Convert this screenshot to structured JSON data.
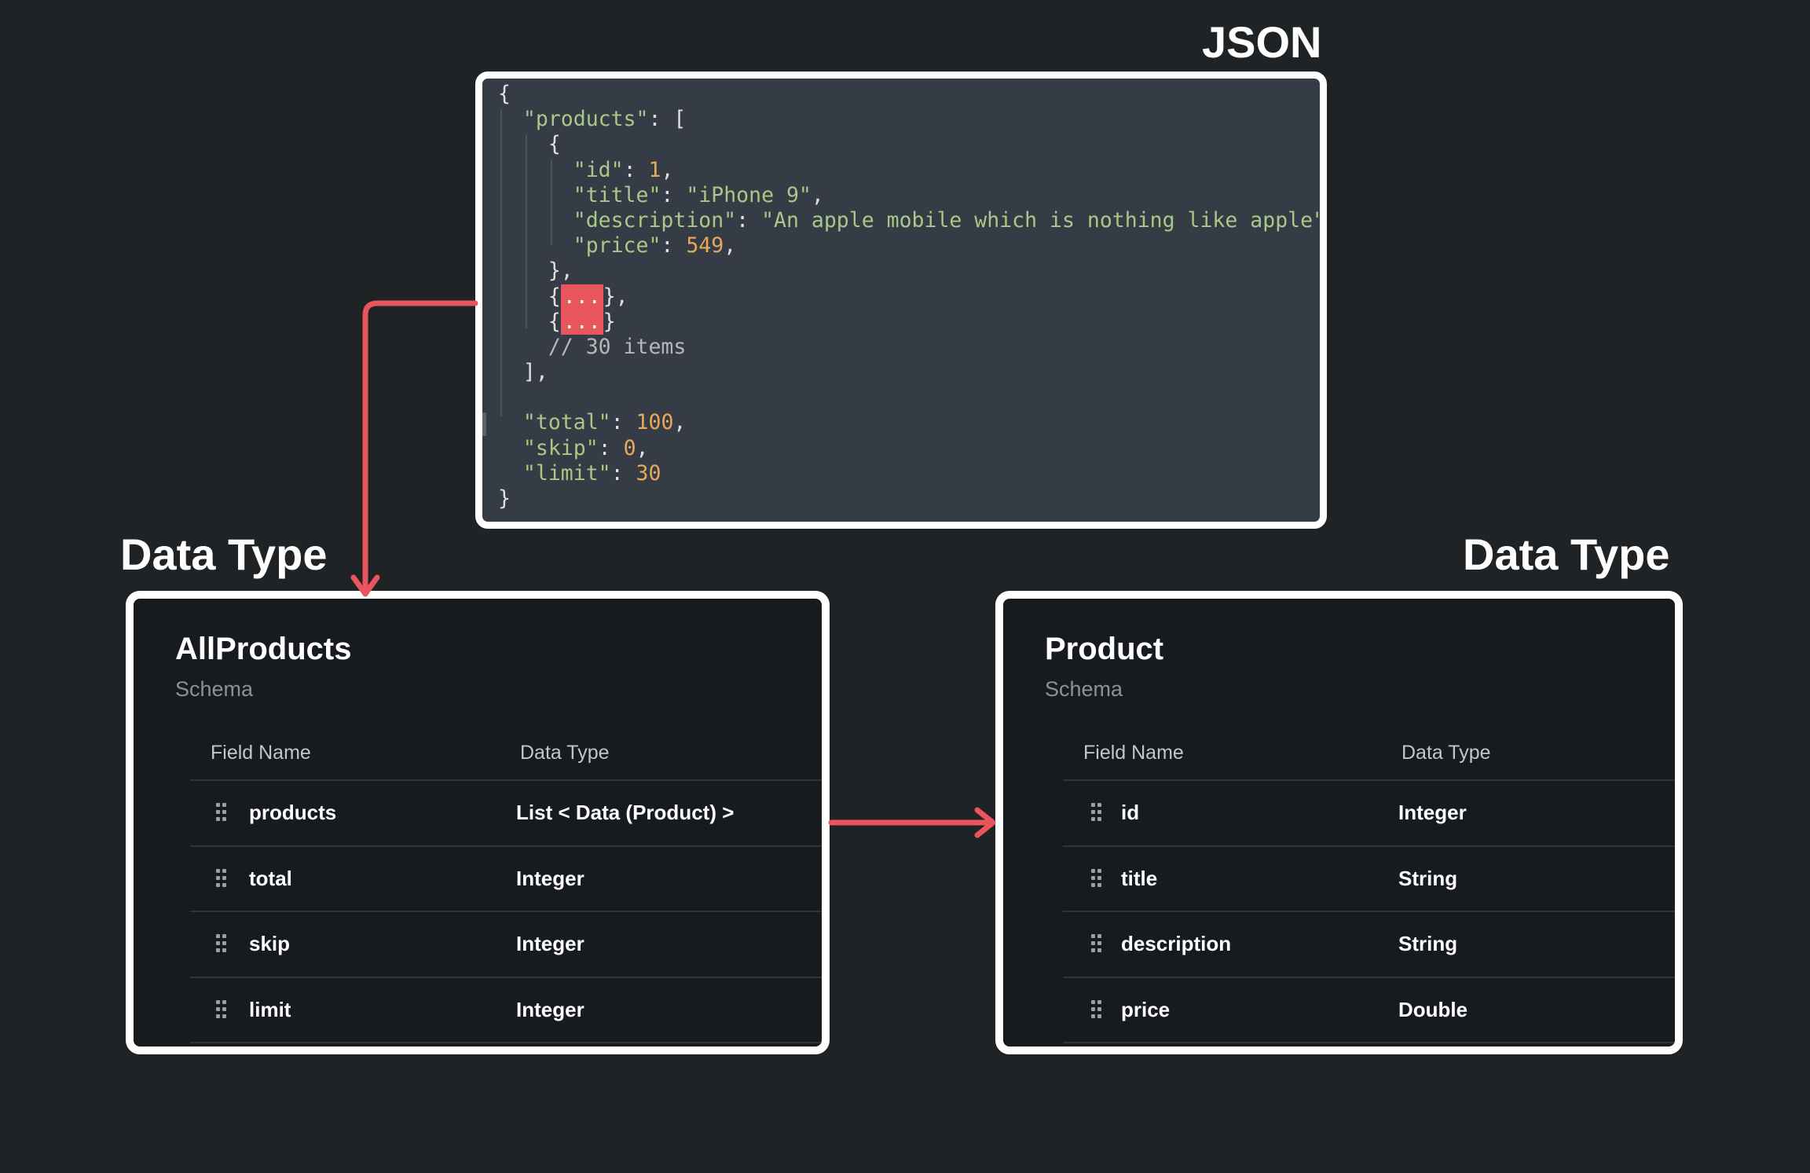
{
  "headings": {
    "json": "JSON",
    "left": "Data Type",
    "right": "Data Type"
  },
  "json_code": {
    "lines": [
      [
        {
          "t": "punc",
          "v": "{"
        }
      ],
      [
        {
          "t": "sp",
          "v": "  "
        },
        {
          "t": "key",
          "v": "\"products\""
        },
        {
          "t": "punc",
          "v": ": ["
        }
      ],
      [
        {
          "t": "sp",
          "v": "    "
        },
        {
          "t": "punc",
          "v": "{"
        }
      ],
      [
        {
          "t": "sp",
          "v": "      "
        },
        {
          "t": "key",
          "v": "\"id\""
        },
        {
          "t": "punc",
          "v": ": "
        },
        {
          "t": "num",
          "v": "1"
        },
        {
          "t": "punc",
          "v": ","
        }
      ],
      [
        {
          "t": "sp",
          "v": "      "
        },
        {
          "t": "key",
          "v": "\"title\""
        },
        {
          "t": "punc",
          "v": ": "
        },
        {
          "t": "str",
          "v": "\"iPhone 9\""
        },
        {
          "t": "punc",
          "v": ","
        }
      ],
      [
        {
          "t": "sp",
          "v": "      "
        },
        {
          "t": "key",
          "v": "\"description\""
        },
        {
          "t": "punc",
          "v": ": "
        },
        {
          "t": "str",
          "v": "\"An apple mobile which is nothing like apple\""
        },
        {
          "t": "punc",
          "v": ","
        }
      ],
      [
        {
          "t": "sp",
          "v": "      "
        },
        {
          "t": "key",
          "v": "\"price\""
        },
        {
          "t": "punc",
          "v": ": "
        },
        {
          "t": "num",
          "v": "549"
        },
        {
          "t": "punc",
          "v": ","
        }
      ],
      [
        {
          "t": "sp",
          "v": "    "
        },
        {
          "t": "punc",
          "v": "},"
        }
      ],
      [
        {
          "t": "sp",
          "v": "    "
        },
        {
          "t": "punc",
          "v": "{"
        },
        {
          "t": "ell",
          "v": "..."
        },
        {
          "t": "punc",
          "v": "},"
        }
      ],
      [
        {
          "t": "sp",
          "v": "    "
        },
        {
          "t": "punc",
          "v": "{"
        },
        {
          "t": "ell",
          "v": "..."
        },
        {
          "t": "punc",
          "v": "}"
        }
      ],
      [
        {
          "t": "sp",
          "v": "    "
        },
        {
          "t": "com",
          "v": "// 30 items"
        }
      ],
      [
        {
          "t": "sp",
          "v": "  "
        },
        {
          "t": "punc",
          "v": "],"
        }
      ],
      [],
      [
        {
          "t": "sp",
          "v": "  "
        },
        {
          "t": "key",
          "v": "\"total\""
        },
        {
          "t": "punc",
          "v": ": "
        },
        {
          "t": "num",
          "v": "100"
        },
        {
          "t": "punc",
          "v": ","
        }
      ],
      [
        {
          "t": "sp",
          "v": "  "
        },
        {
          "t": "key",
          "v": "\"skip\""
        },
        {
          "t": "punc",
          "v": ": "
        },
        {
          "t": "num",
          "v": "0"
        },
        {
          "t": "punc",
          "v": ","
        }
      ],
      [
        {
          "t": "sp",
          "v": "  "
        },
        {
          "t": "key",
          "v": "\"limit\""
        },
        {
          "t": "punc",
          "v": ": "
        },
        {
          "t": "num",
          "v": "30"
        }
      ],
      [
        {
          "t": "punc",
          "v": "}"
        }
      ]
    ]
  },
  "schemas": {
    "left": {
      "title": "AllProducts",
      "subtitle": "Schema",
      "col_field": "Field Name",
      "col_type": "Data Type",
      "rows": [
        {
          "name": "products",
          "type": "List < Data (Product) >"
        },
        {
          "name": "total",
          "type": "Integer"
        },
        {
          "name": "skip",
          "type": "Integer"
        },
        {
          "name": "limit",
          "type": "Integer"
        }
      ]
    },
    "right": {
      "title": "Product",
      "subtitle": "Schema",
      "col_field": "Field Name",
      "col_type": "Data Type",
      "rows": [
        {
          "name": "id",
          "type": "Integer"
        },
        {
          "name": "title",
          "type": "String"
        },
        {
          "name": "description",
          "type": "String"
        },
        {
          "name": "price",
          "type": "Double"
        }
      ]
    }
  },
  "colors": {
    "background": "#1f2326",
    "arrow": "#e8555c",
    "code_panel": "#353c45",
    "card": "#171b1f"
  }
}
